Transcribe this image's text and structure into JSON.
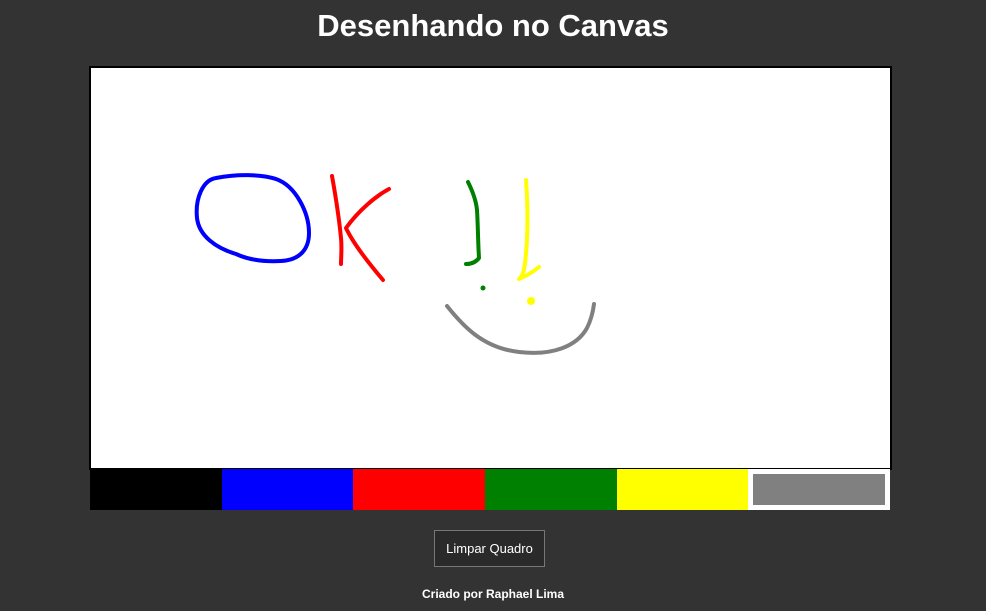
{
  "page": {
    "title": "Desenhando no Canvas"
  },
  "canvas": {
    "background": "#ffffff",
    "strokes": [
      {
        "name": "letter-o",
        "color": "#0000ff"
      },
      {
        "name": "letter-k",
        "color": "#ff0000"
      },
      {
        "name": "exclamation-green",
        "color": "#008000"
      },
      {
        "name": "exclamation-yellow",
        "color": "#ffff00"
      },
      {
        "name": "smile",
        "color": "#808080"
      }
    ]
  },
  "palette": {
    "colors": [
      {
        "name": "black",
        "hex": "#000000"
      },
      {
        "name": "blue",
        "hex": "#0000ff"
      },
      {
        "name": "red",
        "hex": "#ff0000"
      },
      {
        "name": "green",
        "hex": "#008000"
      },
      {
        "name": "yellow",
        "hex": "#ffff00"
      },
      {
        "name": "gray",
        "hex": "#808080",
        "selected": true
      }
    ]
  },
  "controls": {
    "clear_label": "Limpar Quadro"
  },
  "footer": {
    "credit": "Criado por Raphael Lima"
  }
}
